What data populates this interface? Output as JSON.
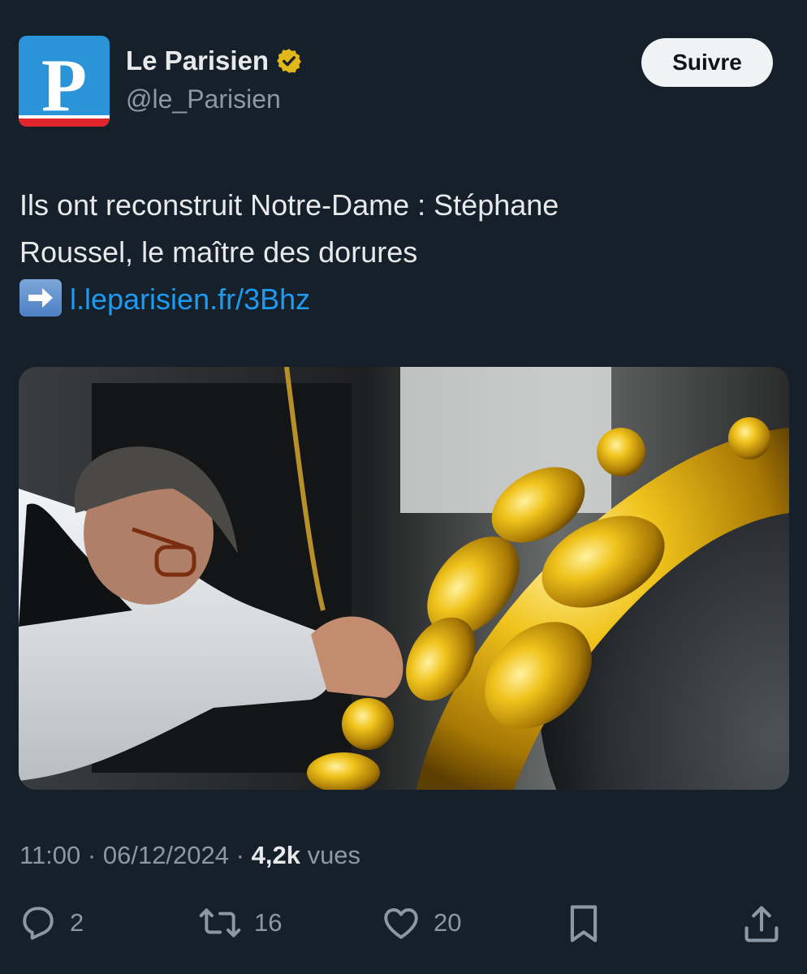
{
  "account": {
    "avatar_letter": "P",
    "display_name": "Le Parisien",
    "handle": "@le_Parisien",
    "verified_icon": "gold-verified-badge"
  },
  "follow_button": {
    "label": "Suivre"
  },
  "tweet": {
    "line1": "Ils ont reconstruit Notre-Dame : Stéphane",
    "line2": "Roussel, le maître des dorures",
    "link_emoji": "➡️",
    "link_text": "l.leparisien.fr/3Bhz"
  },
  "meta": {
    "time": "11:00",
    "date": "06/12/2024",
    "views_count": "4,2k",
    "views_label": "vues",
    "separator": "·"
  },
  "actions": {
    "replies": "2",
    "reposts": "16",
    "likes": "20"
  },
  "colors": {
    "background": "#15202b",
    "link": "#1d9bf0",
    "muted": "#8b98a5",
    "avatar_blue": "#2b93d8",
    "avatar_red": "#e0262b",
    "verified_gold": "#e2b719"
  }
}
